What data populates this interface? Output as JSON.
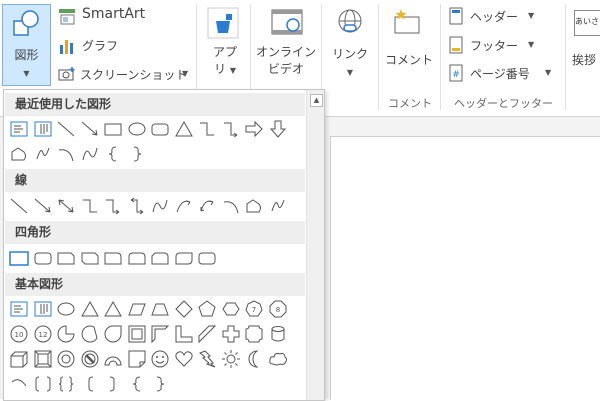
{
  "ribbon": {
    "shapes_label": "図形",
    "smartart_label": "SmartArt",
    "chart_label": "グラフ",
    "screenshot_label": "スクリーンショット",
    "apps_label_line1": "アプ",
    "apps_label_line2": "リ",
    "online_video_line1": "オンライン",
    "online_video_line2": "ビデオ",
    "link_label": "リンク",
    "comment_label": "コメント",
    "comment_group_label": "コメント",
    "header_label": "ヘッダー",
    "footer_label": "フッター",
    "page_number_label": "ページ番号",
    "header_footer_group_label": "ヘッダーとフッター",
    "greeting_label": "挨拶",
    "greeting_icon_text": "あいさつ"
  },
  "gallery": {
    "sections": [
      {
        "title": "最近使用した図形"
      },
      {
        "title": "線"
      },
      {
        "title": "四角形"
      },
      {
        "title": "基本図形"
      }
    ]
  },
  "colors": {
    "ribbon_bg": "#ffffff",
    "accent_blue": "#2b7cd3",
    "selected_button_bg": "#cde8ff",
    "section_header_bg": "#eeeeee"
  }
}
